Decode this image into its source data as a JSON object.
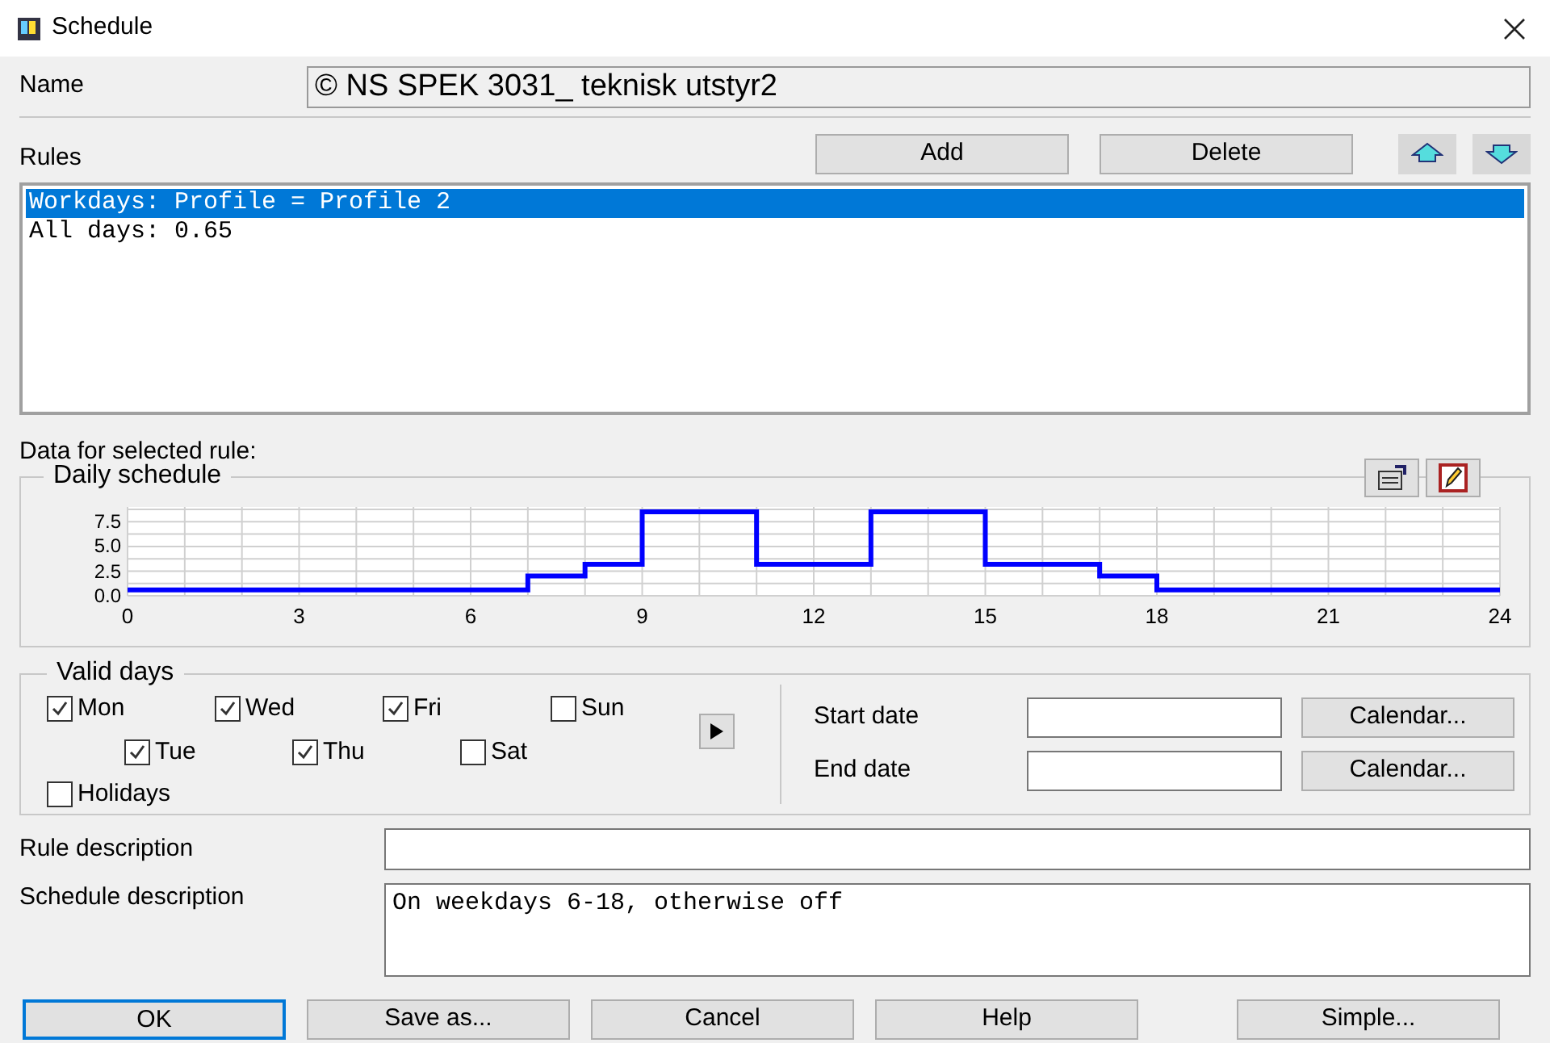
{
  "window": {
    "title": "Schedule"
  },
  "name": {
    "label": "Name",
    "value": "© NS SPEK 3031_ teknisk utstyr2"
  },
  "rules": {
    "label": "Rules",
    "buttons": [
      "Add",
      "Delete"
    ],
    "items": [
      {
        "text": "Workdays: Profile = Profile 2",
        "selected": true
      },
      {
        "text": "All days: 0.65",
        "selected": false
      }
    ]
  },
  "selected_rule": {
    "label": "Data for selected rule:",
    "group_title": "Daily schedule",
    "chart_data": {
      "type": "line",
      "x": [
        0,
        7,
        7,
        8,
        8,
        9,
        9,
        11,
        11,
        13,
        13,
        15,
        15,
        17,
        17,
        18,
        18,
        24
      ],
      "grid": true,
      "series": [
        {
          "color": "#0000ff",
          "values": [
            0.6,
            0.6,
            2,
            2,
            3.2,
            3.2,
            8.5,
            8.5,
            3.2,
            3.2,
            8.5,
            8.5,
            3.2,
            3.2,
            2,
            2,
            0.6,
            0.6
          ]
        }
      ],
      "xlim": [
        0,
        24
      ],
      "ylim": [
        0,
        9
      ],
      "xticks": [
        0,
        3,
        6,
        9,
        12,
        15,
        18,
        21,
        24
      ],
      "yticks": [
        {
          "value": 0,
          "label": "0.0"
        },
        {
          "value": 2.5,
          "label": "2.5"
        },
        {
          "value": 5,
          "label": "5.0"
        },
        {
          "value": 7.5,
          "label": "7.5"
        }
      ]
    }
  },
  "valid_days": {
    "title": "Valid days",
    "rows": [
      {
        "days": [
          {
            "label": "Mon",
            "checked": true
          },
          {
            "label": "Wed",
            "checked": true
          },
          {
            "label": "Fri",
            "checked": true
          },
          {
            "label": "Sun",
            "checked": false
          }
        ]
      },
      {
        "days": [
          {
            "label": "Tue",
            "checked": true
          },
          {
            "label": "Thu",
            "checked": true
          },
          {
            "label": "Sat",
            "checked": false
          }
        ]
      },
      {
        "days": [
          {
            "label": "Holidays",
            "checked": false
          }
        ]
      }
    ]
  },
  "dates": [
    {
      "label": "Start date",
      "button": "Calendar..."
    },
    {
      "label": "End date",
      "button": "Calendar..."
    }
  ],
  "rule_description": {
    "label": "Rule description"
  },
  "schedule_description": {
    "label": "Schedule description",
    "value": "On weekdays 6-18, otherwise off"
  },
  "buttons": [
    {
      "label": "OK",
      "selected": true
    },
    {
      "label": "Save as...",
      "selected": false
    },
    {
      "label": "Cancel",
      "selected": false
    },
    {
      "label": "Help",
      "selected": false
    },
    {
      "label": "Simple...",
      "selected": false
    }
  ]
}
